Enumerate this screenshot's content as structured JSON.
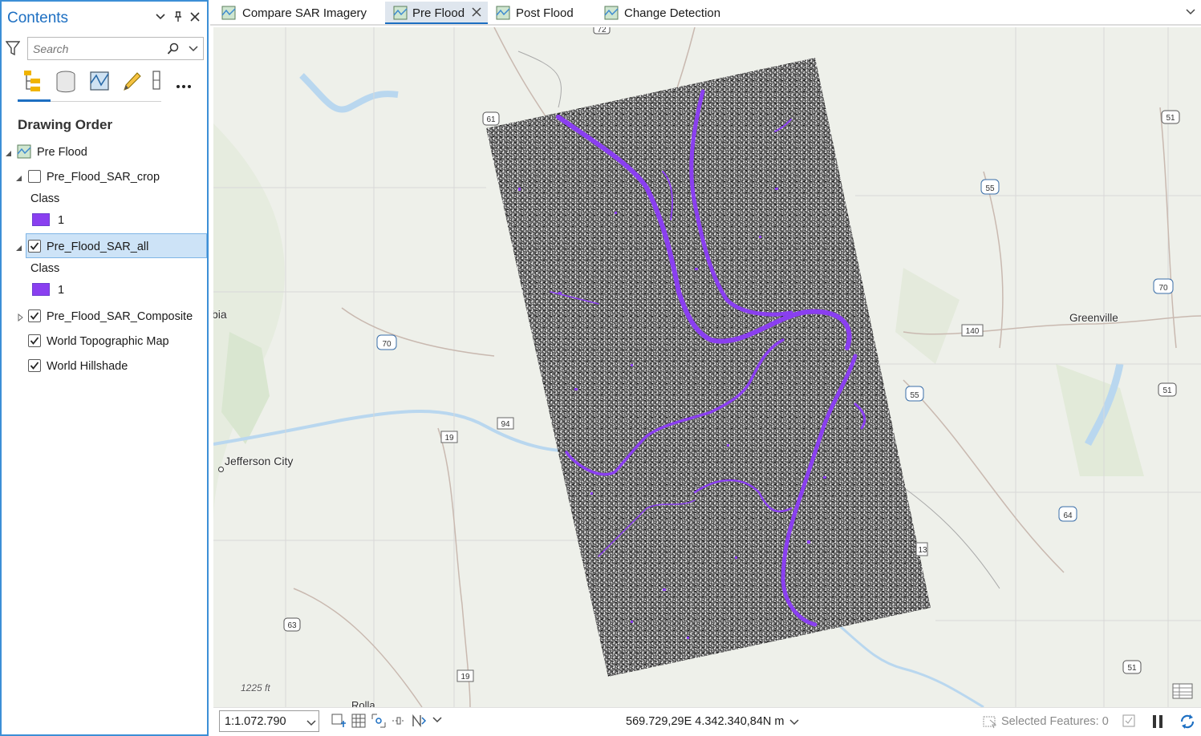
{
  "contents": {
    "title": "Contents",
    "search_placeholder": "Search",
    "section_title": "Drawing Order",
    "map_name": "Pre Flood",
    "layers": [
      {
        "name": "Pre_Flood_SAR_crop",
        "checked": false,
        "class_header": "Class",
        "class_value": "1",
        "color": "#8a3ff0"
      },
      {
        "name": "Pre_Flood_SAR_all",
        "checked": true,
        "selected": true,
        "class_header": "Class",
        "class_value": "1",
        "color": "#8a3ff0"
      },
      {
        "name": "Pre_Flood_SAR_Composite",
        "checked": true
      },
      {
        "name": "World Topographic Map",
        "checked": true
      },
      {
        "name": "World Hillshade",
        "checked": true
      }
    ]
  },
  "tabs": [
    {
      "label": "Compare SAR Imagery",
      "active": false
    },
    {
      "label": "Pre Flood",
      "active": true
    },
    {
      "label": "Post Flood",
      "active": false
    },
    {
      "label": "Change Detection",
      "active": false
    }
  ],
  "map": {
    "places": {
      "jefferson_city": "Jefferson City",
      "greenville": "Greenville",
      "rolla": "Rolla",
      "bia": "bia",
      "elevation": "1225 ft"
    },
    "shields": [
      "61",
      "72",
      "51",
      "55",
      "70",
      "140",
      "94",
      "19",
      "55",
      "51",
      "64",
      "63",
      "19",
      "51",
      "70",
      "13"
    ],
    "flood_color": "#8a3ff0"
  },
  "status": {
    "scale": "1:1.072.790",
    "coordinates": "569.729,29E 4.342.340,84N m",
    "selected_features": "Selected Features: 0"
  }
}
